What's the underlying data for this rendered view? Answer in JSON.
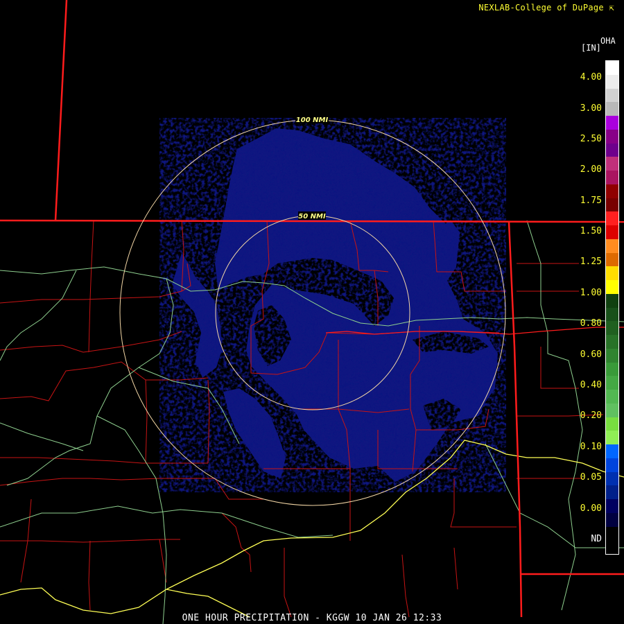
{
  "credit": "NEXLAB-College of DuPage",
  "credit_icon": "external-link-arrow-icon",
  "product_code": "OHA",
  "units": "[IN]",
  "title": "ONE HOUR PRECIPITATION - KGGW 10 JAN 26 12:33",
  "range_rings": [
    {
      "label": "100 NMI",
      "distance_nmi": 100
    },
    {
      "label": "50 NMI",
      "distance_nmi": 50
    }
  ],
  "legend": {
    "ticks": [
      "4.00",
      "3.00",
      "2.50",
      "2.00",
      "1.75",
      "1.50",
      "1.25",
      "1.00",
      "0.80",
      "0.60",
      "0.40",
      "0.20",
      "0.10",
      "0.05",
      "0.00",
      "ND"
    ],
    "colors": [
      "#ffffff",
      "#ececec",
      "#d2d2d2",
      "#b9b9b9",
      "#aa00dd",
      "#880088",
      "#6e008c",
      "#c0307a",
      "#aa1460",
      "#900000",
      "#780000",
      "#ff2020",
      "#dd0000",
      "#ff8c20",
      "#dd6a00",
      "#ffdd00",
      "#ffff00",
      "#104010",
      "#18501a",
      "#206020",
      "#287228",
      "#308430",
      "#399a39",
      "#44a844",
      "#52b752",
      "#60c060",
      "#78dd40",
      "#90ee55",
      "#0066ff",
      "#0044dd",
      "#0030b0",
      "#00208a",
      "#000060",
      "#000040",
      "#000000",
      "#000000"
    ]
  },
  "colors": {
    "precip_fill": "#0f1680",
    "state_border": "#ff1c1c",
    "county_line": "#c81414",
    "highway": "#ffff55",
    "road": "#8fd08f",
    "ring": "#f4d7a6"
  }
}
